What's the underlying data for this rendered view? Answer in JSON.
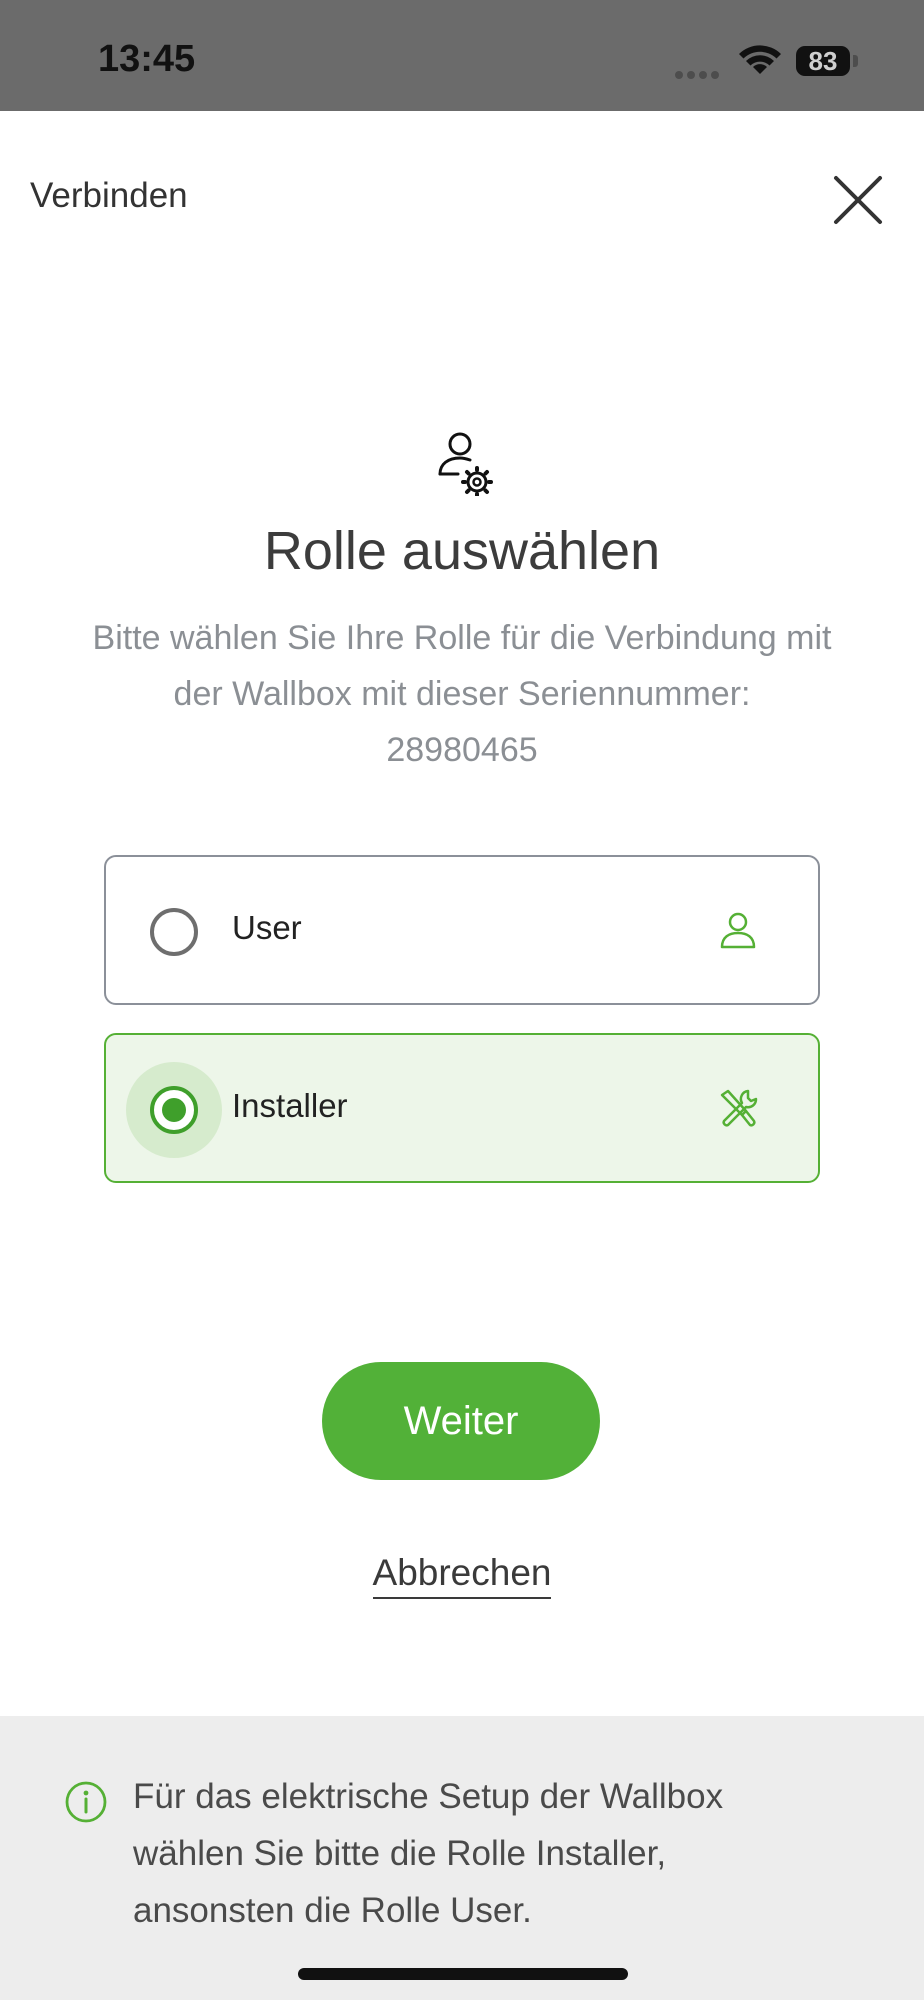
{
  "status_bar": {
    "time": "13:45",
    "battery": "83",
    "icons": [
      "signal-dots-icon",
      "wifi-icon",
      "battery-icon"
    ]
  },
  "header": {
    "title": "Verbinden",
    "close_icon": "close-icon"
  },
  "main": {
    "icon": "user-gear-icon",
    "title": "Rolle auswählen",
    "description_line1": "Bitte wählen Sie Ihre Rolle für die Verbindung mit",
    "description_line2": "der Wallbox mit dieser Seriennummer:",
    "serial_number": "28980465"
  },
  "options": [
    {
      "label": "User",
      "selected": false,
      "icon": "user-icon"
    },
    {
      "label": "Installer",
      "selected": true,
      "icon": "tools-icon"
    }
  ],
  "actions": {
    "primary_label": "Weiter",
    "cancel_label": "Abbrechen"
  },
  "info": {
    "icon": "info-icon",
    "text_line1": "Für das elektrische Setup der Wallbox",
    "text_line2": "wählen Sie bitte die Rolle Installer,",
    "text_line3": "ansonsten die Rolle User."
  },
  "colors": {
    "accent": "#52b138",
    "selected_background": "#edf6e9",
    "status_bar": "#6b6b6b",
    "info_background": "#ededed"
  }
}
